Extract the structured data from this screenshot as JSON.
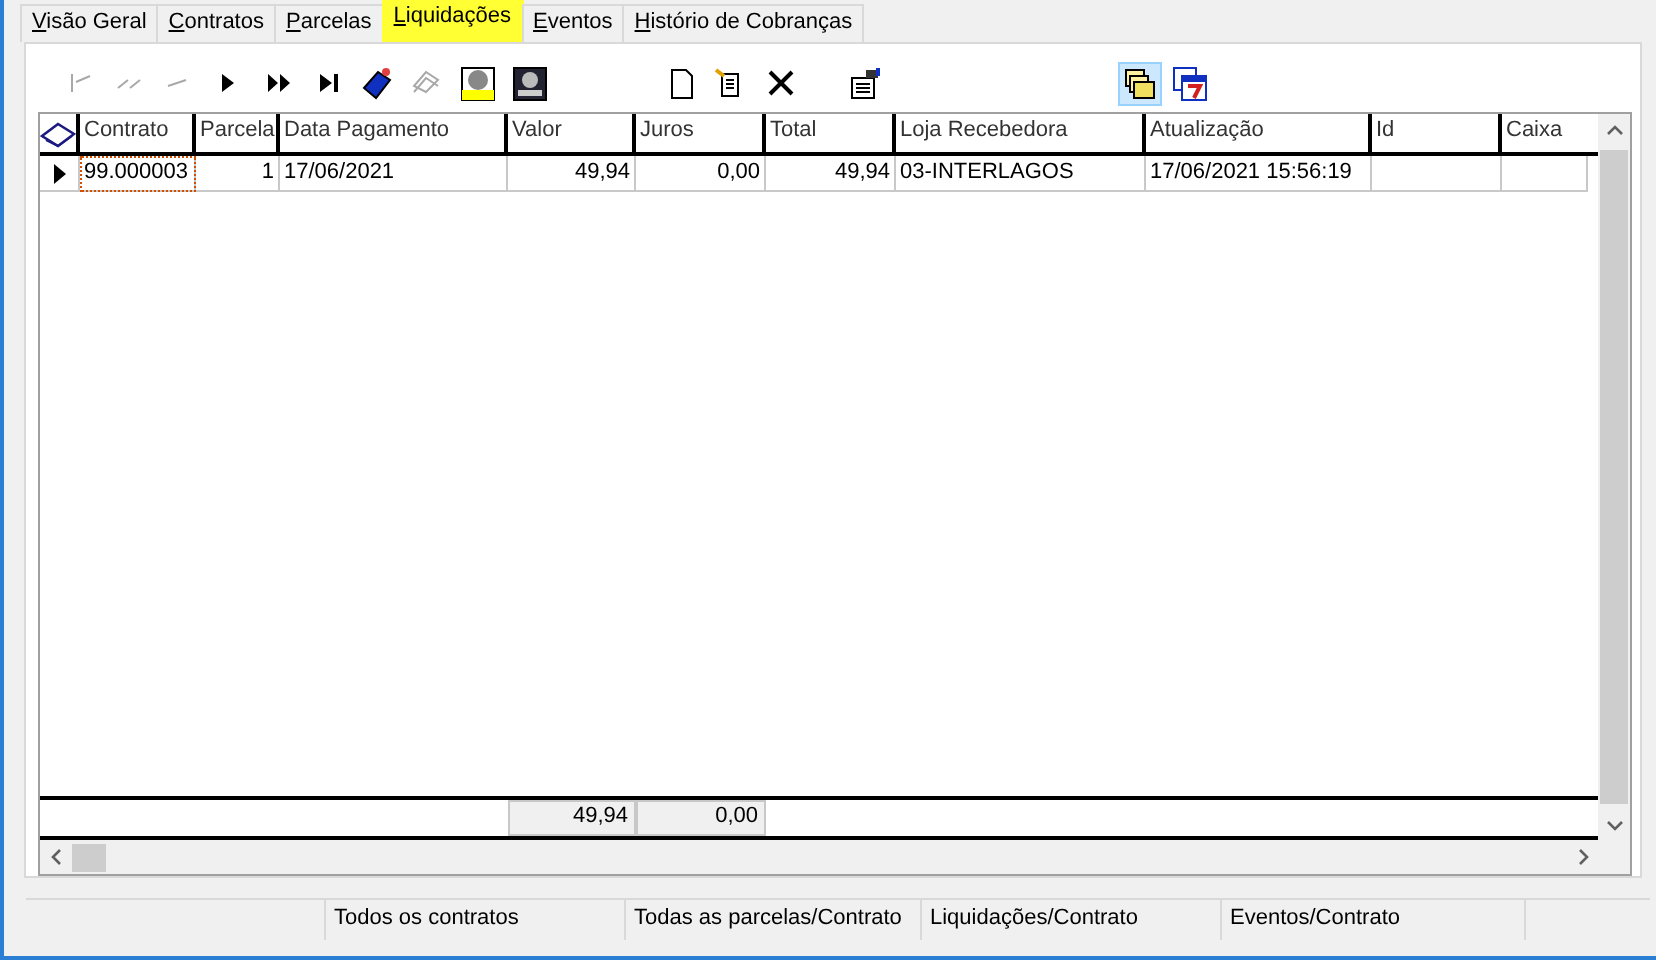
{
  "tabs": [
    {
      "label": "Visão Geral",
      "selected": false
    },
    {
      "label": "Contratos",
      "selected": false
    },
    {
      "label": "Parcelas",
      "selected": false
    },
    {
      "label": "Liquidações",
      "selected": true
    },
    {
      "label": "Eventos",
      "selected": false
    },
    {
      "label": "Histório de Cobranças",
      "selected": false
    }
  ],
  "toolbar": [
    {
      "kind": "first",
      "disabled": true,
      "pressed": false
    },
    {
      "kind": "prior-page",
      "disabled": true,
      "pressed": false
    },
    {
      "kind": "prior",
      "disabled": true,
      "pressed": false
    },
    {
      "kind": "next",
      "disabled": false,
      "pressed": false
    },
    {
      "kind": "next-page",
      "disabled": false,
      "pressed": false
    },
    {
      "kind": "last",
      "disabled": false,
      "pressed": false
    },
    {
      "kind": "tag",
      "disabled": false,
      "pressed": false
    },
    {
      "kind": "goto",
      "disabled": true,
      "pressed": false
    },
    {
      "kind": "filter",
      "disabled": false,
      "pressed": false
    },
    {
      "kind": "monitor",
      "disabled": false,
      "pressed": false
    },
    {
      "kind": "new",
      "disabled": false,
      "pressed": false
    },
    {
      "kind": "edit",
      "disabled": false,
      "pressed": false
    },
    {
      "kind": "delete",
      "disabled": false,
      "pressed": false
    },
    {
      "kind": "properties",
      "disabled": false,
      "pressed": false
    },
    {
      "kind": "folders",
      "disabled": false,
      "pressed": true
    },
    {
      "kind": "calendar",
      "disabled": false,
      "pressed": false
    }
  ],
  "table": {
    "columns": [
      {
        "label": "Contrato",
        "kind": "text"
      },
      {
        "label": "Parcela",
        "kind": "number"
      },
      {
        "label": "Data Pagamento",
        "kind": "text"
      },
      {
        "label": "Valor",
        "kind": "number"
      },
      {
        "label": "Juros",
        "kind": "number"
      },
      {
        "label": "Total",
        "kind": "number"
      },
      {
        "label": "Loja Recebedora",
        "kind": "text"
      },
      {
        "label": "Atualização",
        "kind": "text"
      },
      {
        "label": "Id",
        "kind": "text"
      },
      {
        "label": "Caixa",
        "kind": "text"
      }
    ],
    "rows": [
      {
        "selected": true,
        "cells": [
          "99.000003",
          "1",
          "17/06/2021",
          "49,94",
          "0,00",
          "49,94",
          "03-INTERLAGOS",
          "17/06/2021 15:56:19"
        ]
      }
    ],
    "footer": {
      "valor": "49,94",
      "juros": "0,00"
    }
  },
  "status_bar": [
    "Todos os contratos",
    "Todas as parcelas/Contrato",
    "Liquidações/Contrato",
    "Eventos/Contrato"
  ]
}
